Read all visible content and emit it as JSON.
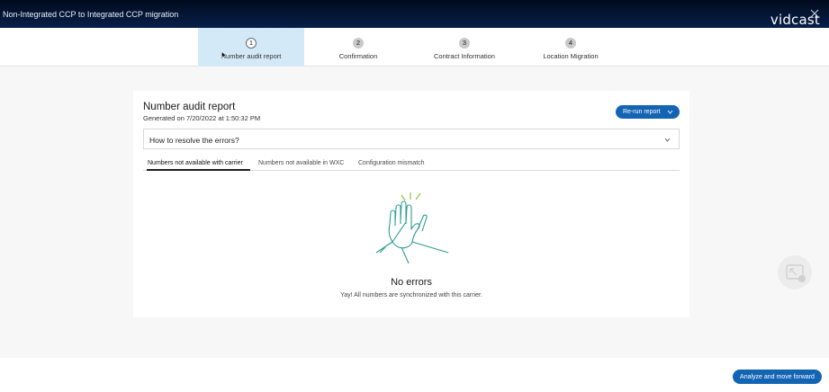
{
  "window": {
    "title": "Non-Integrated CCP to Integrated CCP migration",
    "brand": "vidcast"
  },
  "steps": [
    {
      "number": "1",
      "label": "Number audit report",
      "active": true
    },
    {
      "number": "2",
      "label": "Confirmation",
      "active": false
    },
    {
      "number": "3",
      "label": "Contract Information",
      "active": false
    },
    {
      "number": "4",
      "label": "Location Migration",
      "active": false
    }
  ],
  "report": {
    "title": "Number audit report",
    "generated": "Generated on 7/20/2022 at 1:50:32 PM",
    "rerun_label": "Re-run report",
    "accordion_question": "How to resolve the errors?"
  },
  "tabs": [
    {
      "label": "Numbers not available with carrier",
      "active": true
    },
    {
      "label": "Numbers not available in WXC",
      "active": false
    },
    {
      "label": "Configuration mismatch",
      "active": false
    }
  ],
  "empty_state": {
    "title": "No errors",
    "message": "Yay! All numbers are synchronized with this carrier."
  },
  "footer": {
    "forward_label": "Analyze and move forward"
  },
  "colors": {
    "accent": "#1464b4",
    "active_step_bg": "#d4e9f8",
    "illustration_teal": "#2a9d8f",
    "illustration_green": "#8cc63f"
  }
}
